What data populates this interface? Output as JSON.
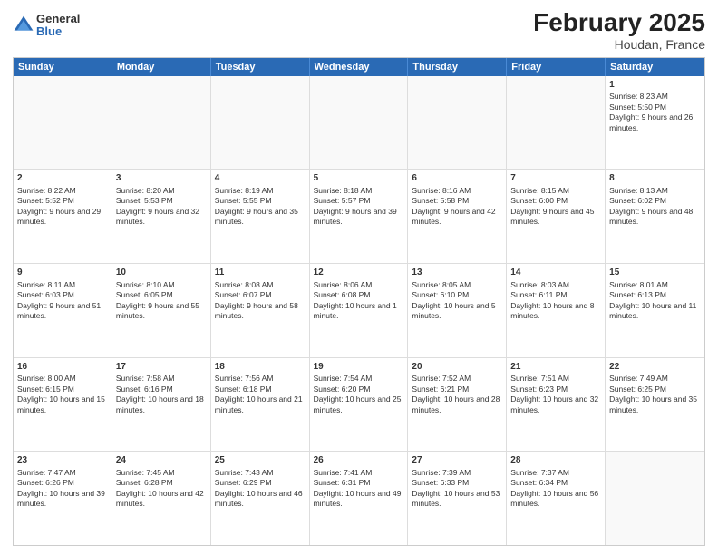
{
  "header": {
    "logo": {
      "general": "General",
      "blue": "Blue"
    },
    "title": "February 2025",
    "subtitle": "Houdan, France"
  },
  "days": [
    "Sunday",
    "Monday",
    "Tuesday",
    "Wednesday",
    "Thursday",
    "Friday",
    "Saturday"
  ],
  "weeks": [
    [
      {
        "day": "",
        "info": ""
      },
      {
        "day": "",
        "info": ""
      },
      {
        "day": "",
        "info": ""
      },
      {
        "day": "",
        "info": ""
      },
      {
        "day": "",
        "info": ""
      },
      {
        "day": "",
        "info": ""
      },
      {
        "day": "1",
        "info": "Sunrise: 8:23 AM\nSunset: 5:50 PM\nDaylight: 9 hours and 26 minutes."
      }
    ],
    [
      {
        "day": "2",
        "info": "Sunrise: 8:22 AM\nSunset: 5:52 PM\nDaylight: 9 hours and 29 minutes."
      },
      {
        "day": "3",
        "info": "Sunrise: 8:20 AM\nSunset: 5:53 PM\nDaylight: 9 hours and 32 minutes."
      },
      {
        "day": "4",
        "info": "Sunrise: 8:19 AM\nSunset: 5:55 PM\nDaylight: 9 hours and 35 minutes."
      },
      {
        "day": "5",
        "info": "Sunrise: 8:18 AM\nSunset: 5:57 PM\nDaylight: 9 hours and 39 minutes."
      },
      {
        "day": "6",
        "info": "Sunrise: 8:16 AM\nSunset: 5:58 PM\nDaylight: 9 hours and 42 minutes."
      },
      {
        "day": "7",
        "info": "Sunrise: 8:15 AM\nSunset: 6:00 PM\nDaylight: 9 hours and 45 minutes."
      },
      {
        "day": "8",
        "info": "Sunrise: 8:13 AM\nSunset: 6:02 PM\nDaylight: 9 hours and 48 minutes."
      }
    ],
    [
      {
        "day": "9",
        "info": "Sunrise: 8:11 AM\nSunset: 6:03 PM\nDaylight: 9 hours and 51 minutes."
      },
      {
        "day": "10",
        "info": "Sunrise: 8:10 AM\nSunset: 6:05 PM\nDaylight: 9 hours and 55 minutes."
      },
      {
        "day": "11",
        "info": "Sunrise: 8:08 AM\nSunset: 6:07 PM\nDaylight: 9 hours and 58 minutes."
      },
      {
        "day": "12",
        "info": "Sunrise: 8:06 AM\nSunset: 6:08 PM\nDaylight: 10 hours and 1 minute."
      },
      {
        "day": "13",
        "info": "Sunrise: 8:05 AM\nSunset: 6:10 PM\nDaylight: 10 hours and 5 minutes."
      },
      {
        "day": "14",
        "info": "Sunrise: 8:03 AM\nSunset: 6:11 PM\nDaylight: 10 hours and 8 minutes."
      },
      {
        "day": "15",
        "info": "Sunrise: 8:01 AM\nSunset: 6:13 PM\nDaylight: 10 hours and 11 minutes."
      }
    ],
    [
      {
        "day": "16",
        "info": "Sunrise: 8:00 AM\nSunset: 6:15 PM\nDaylight: 10 hours and 15 minutes."
      },
      {
        "day": "17",
        "info": "Sunrise: 7:58 AM\nSunset: 6:16 PM\nDaylight: 10 hours and 18 minutes."
      },
      {
        "day": "18",
        "info": "Sunrise: 7:56 AM\nSunset: 6:18 PM\nDaylight: 10 hours and 21 minutes."
      },
      {
        "day": "19",
        "info": "Sunrise: 7:54 AM\nSunset: 6:20 PM\nDaylight: 10 hours and 25 minutes."
      },
      {
        "day": "20",
        "info": "Sunrise: 7:52 AM\nSunset: 6:21 PM\nDaylight: 10 hours and 28 minutes."
      },
      {
        "day": "21",
        "info": "Sunrise: 7:51 AM\nSunset: 6:23 PM\nDaylight: 10 hours and 32 minutes."
      },
      {
        "day": "22",
        "info": "Sunrise: 7:49 AM\nSunset: 6:25 PM\nDaylight: 10 hours and 35 minutes."
      }
    ],
    [
      {
        "day": "23",
        "info": "Sunrise: 7:47 AM\nSunset: 6:26 PM\nDaylight: 10 hours and 39 minutes."
      },
      {
        "day": "24",
        "info": "Sunrise: 7:45 AM\nSunset: 6:28 PM\nDaylight: 10 hours and 42 minutes."
      },
      {
        "day": "25",
        "info": "Sunrise: 7:43 AM\nSunset: 6:29 PM\nDaylight: 10 hours and 46 minutes."
      },
      {
        "day": "26",
        "info": "Sunrise: 7:41 AM\nSunset: 6:31 PM\nDaylight: 10 hours and 49 minutes."
      },
      {
        "day": "27",
        "info": "Sunrise: 7:39 AM\nSunset: 6:33 PM\nDaylight: 10 hours and 53 minutes."
      },
      {
        "day": "28",
        "info": "Sunrise: 7:37 AM\nSunset: 6:34 PM\nDaylight: 10 hours and 56 minutes."
      },
      {
        "day": "",
        "info": ""
      }
    ]
  ]
}
